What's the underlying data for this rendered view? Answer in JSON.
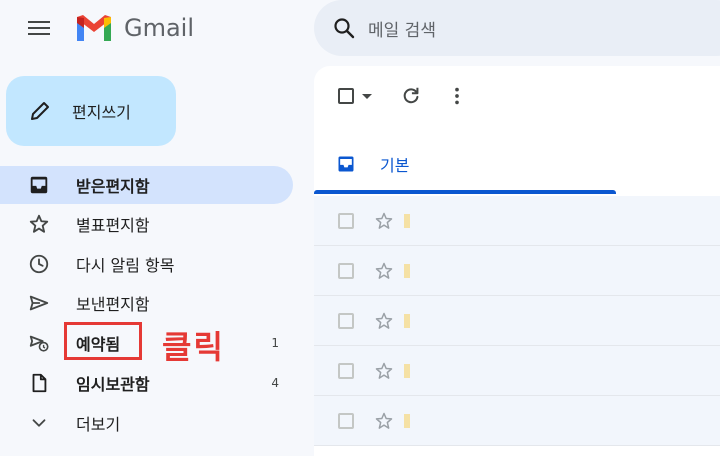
{
  "header": {
    "app_name": "Gmail",
    "search_placeholder": "메일 검색"
  },
  "compose": {
    "label": "편지쓰기"
  },
  "sidebar": {
    "items": [
      {
        "label": "받은편지함",
        "icon": "inbox-icon",
        "active": true,
        "bold": true,
        "count": ""
      },
      {
        "label": "별표편지함",
        "icon": "star-icon",
        "active": false,
        "bold": false,
        "count": ""
      },
      {
        "label": "다시 알림 항목",
        "icon": "clock-icon",
        "active": false,
        "bold": false,
        "count": ""
      },
      {
        "label": "보낸편지함",
        "icon": "send-icon",
        "active": false,
        "bold": false,
        "count": ""
      },
      {
        "label": "예약됨",
        "icon": "scheduled-send-icon",
        "active": false,
        "bold": true,
        "count": "1"
      },
      {
        "label": "임시보관함",
        "icon": "draft-icon",
        "active": false,
        "bold": true,
        "count": "4"
      },
      {
        "label": "더보기",
        "icon": "chevron-down-icon",
        "active": false,
        "bold": false,
        "count": ""
      }
    ]
  },
  "annotation": {
    "text": "클릭",
    "color": "#e53935"
  },
  "main": {
    "tabs": [
      {
        "label": "기본",
        "icon": "inbox-icon"
      }
    ],
    "row_count": 5
  },
  "colors": {
    "accent": "#0b57d0",
    "compose_bg": "#c2e7ff",
    "active_nav": "#d3e3fd",
    "background": "#f6f8fc"
  }
}
